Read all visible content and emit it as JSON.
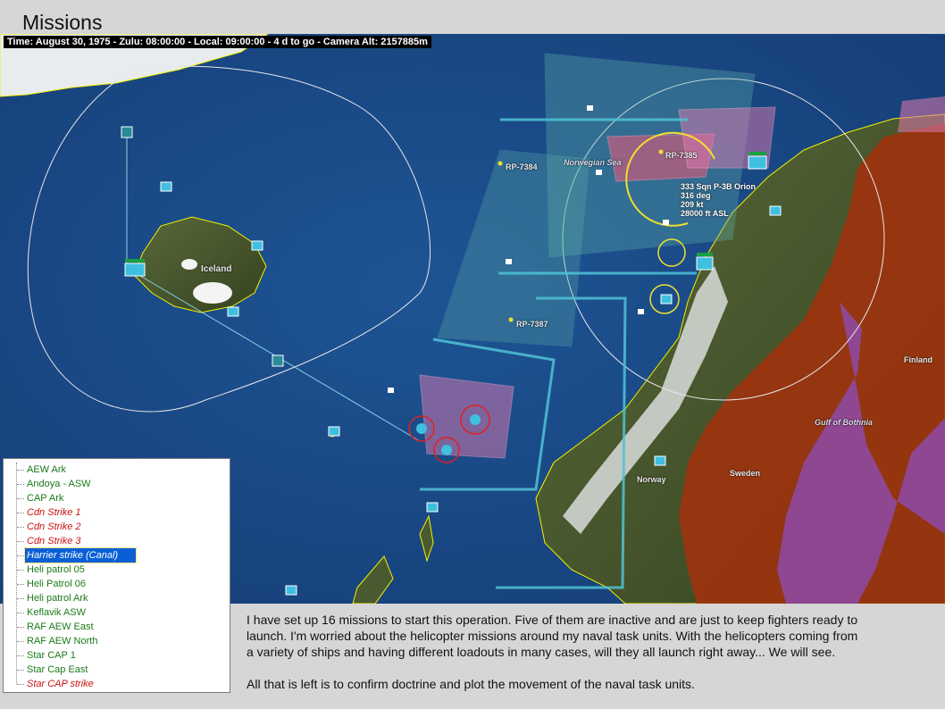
{
  "page": {
    "title": "Missions"
  },
  "status_bar": {
    "text": "Time: August 30, 1975 - Zulu: 08:00:00 - Local: 09:00:00 - 4 d to go -  Camera Alt: 2157885m"
  },
  "map": {
    "labels": {
      "iceland": "Iceland",
      "norwegian_sea": "Norwegian Sea",
      "rp_7384": "RP-7384",
      "rp_7385": "RP-7385",
      "rp_7387": "RP-7387",
      "norway": "Norway",
      "sweden": "Sweden",
      "finland": "Finland",
      "gulf_of_bothnia": "Gulf of Bothnia"
    },
    "unit_callout": [
      "333 Sqn P-3B Orion",
      "316 deg",
      "209 kt",
      "28000 ft ASL"
    ],
    "colors": {
      "sea": "#1c4f8e",
      "land": "#4a5a30",
      "enemy_territory": "#a0320e",
      "patrol_zone": "#5fb0a8",
      "strike_zone": "#e07ab0",
      "route": "#4fc3d6",
      "coastline": "#f2f000"
    }
  },
  "missions": [
    {
      "label": "AEW Ark",
      "state": "active"
    },
    {
      "label": "Andoya - ASW",
      "state": "active"
    },
    {
      "label": "CAP Ark",
      "state": "active"
    },
    {
      "label": "Cdn Strike 1",
      "state": "inactive"
    },
    {
      "label": "Cdn Strike 2",
      "state": "inactive"
    },
    {
      "label": "Cdn Strike 3",
      "state": "inactive"
    },
    {
      "label": "Harrier strike (Canal)",
      "state": "selected"
    },
    {
      "label": "Heli patrol 05",
      "state": "active"
    },
    {
      "label": "Heli Patrol 06",
      "state": "active"
    },
    {
      "label": "Heli patrol Ark",
      "state": "active"
    },
    {
      "label": "Keflavik ASW",
      "state": "active"
    },
    {
      "label": "RAF AEW East",
      "state": "active"
    },
    {
      "label": "RAF AEW North",
      "state": "active"
    },
    {
      "label": "Star CAP 1",
      "state": "active"
    },
    {
      "label": "Star Cap East",
      "state": "active"
    },
    {
      "label": "Star CAP strike",
      "state": "inactive"
    }
  ],
  "caption": {
    "paragraph1": "I have set up 16 missions to start this operation. Five of them are inactive and are just to keep fighters ready to launch.  I'm worried about the helicopter missions around my naval task units. With the helicopters coming from a variety of ships and having different loadouts in many cases, will they all launch right away...  We will see.",
    "paragraph2": "All that is left is to confirm doctrine and plot the movement of the naval task units."
  }
}
